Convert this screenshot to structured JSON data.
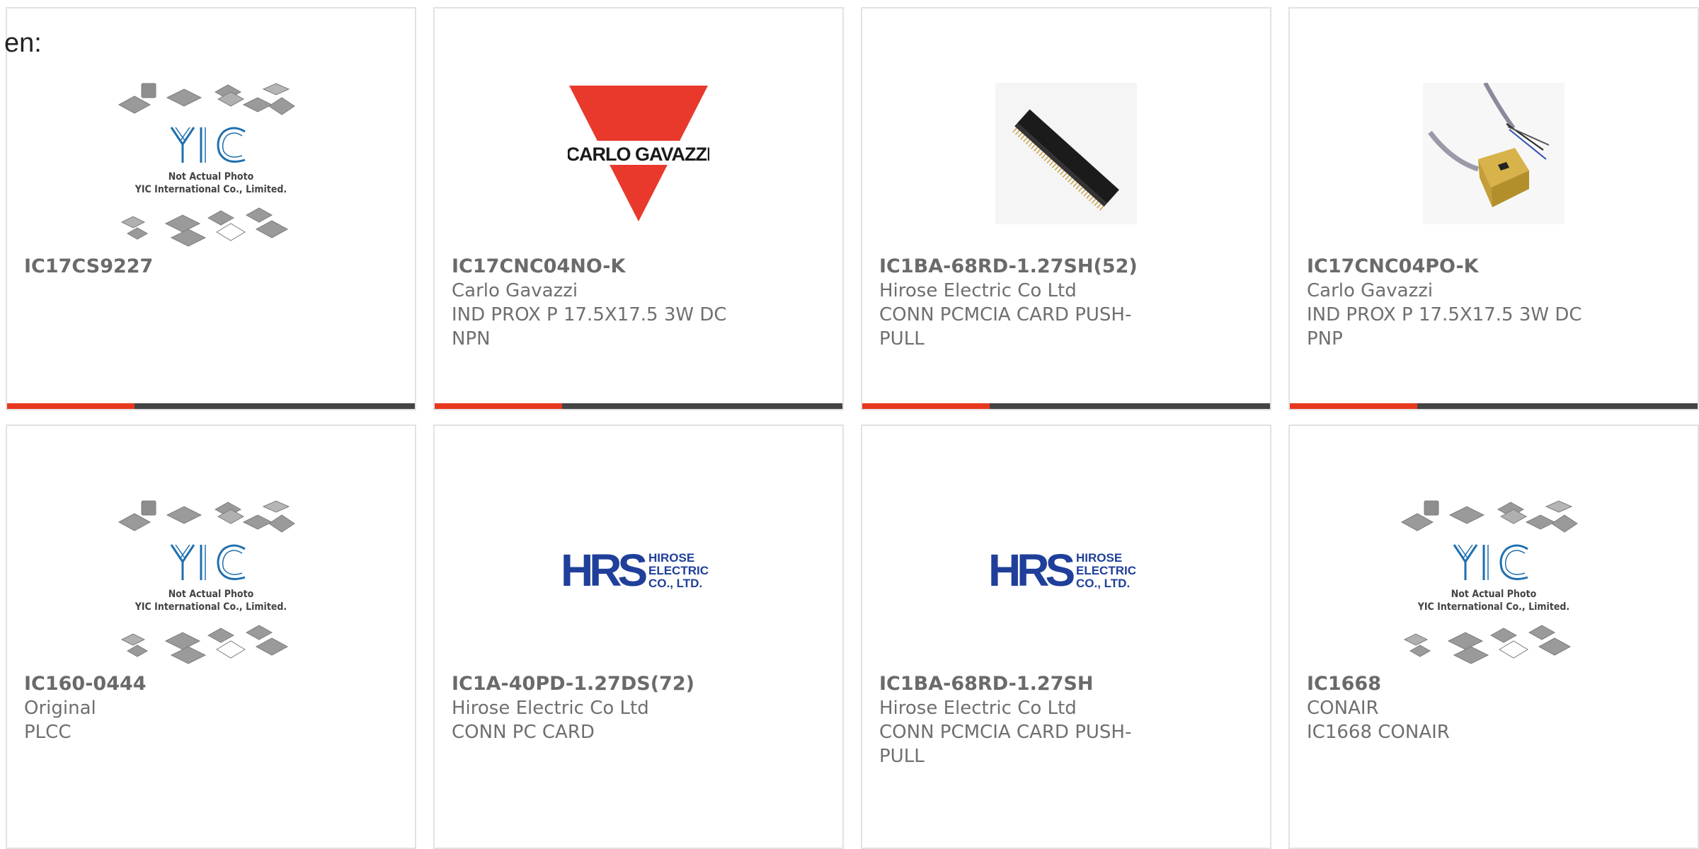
{
  "language_label": "en:",
  "colors": {
    "accent_bar": "#e8381e",
    "dark_bar": "#444444",
    "yic_logo_blue": "#1f6fae",
    "carlo_gavazzi_red": "#e8392c",
    "hrs_blue": "#1f3f9a"
  },
  "products": [
    {
      "part": "IC17CS9227",
      "manufacturer": "",
      "description": "",
      "image": "yic-placeholder",
      "image_caption_1": "Not Actual Photo",
      "image_caption_2": "YIC International Co., Limited."
    },
    {
      "part": "IC17CNC04NO-K",
      "manufacturer": "Carlo Gavazzi",
      "description": "IND PROX P 17.5X17.5 3W DC NPN",
      "image": "carlo-gavazzi-logo",
      "logo_text": "CARLO GAVAZZI"
    },
    {
      "part": "IC1BA-68RD-1.27SH(52)",
      "manufacturer": "Hirose Electric Co Ltd",
      "description": "CONN PCMCIA CARD PUSH-PULL",
      "image": "connector-photo"
    },
    {
      "part": "IC17CNC04PO-K",
      "manufacturer": "Carlo Gavazzi",
      "description": "IND PROX P 17.5X17.5 3W DC PNP",
      "image": "proximity-sensor-photo"
    },
    {
      "part": "IC160-0444",
      "manufacturer": "Original",
      "description": "PLCC",
      "image": "yic-placeholder",
      "image_caption_1": "Not Actual Photo",
      "image_caption_2": "YIC International Co., Limited."
    },
    {
      "part": "IC1A-40PD-1.27DS(72)",
      "manufacturer": "Hirose Electric Co Ltd",
      "description": "CONN PC CARD",
      "image": "hrs-logo",
      "logo_mark": "HRS",
      "logo_lines": [
        "HIROSE",
        "ELECTRIC",
        "CO., LTD."
      ]
    },
    {
      "part": "IC1BA-68RD-1.27SH",
      "manufacturer": "Hirose Electric Co Ltd",
      "description": "CONN PCMCIA CARD PUSH-PULL",
      "image": "hrs-logo",
      "logo_mark": "HRS",
      "logo_lines": [
        "HIROSE",
        "ELECTRIC",
        "CO., LTD."
      ]
    },
    {
      "part": "IC1668",
      "manufacturer": "CONAIR",
      "description": "IC1668 CONAIR",
      "image": "yic-placeholder",
      "image_caption_1": "Not Actual Photo",
      "image_caption_2": "YIC International Co., Limited."
    }
  ]
}
